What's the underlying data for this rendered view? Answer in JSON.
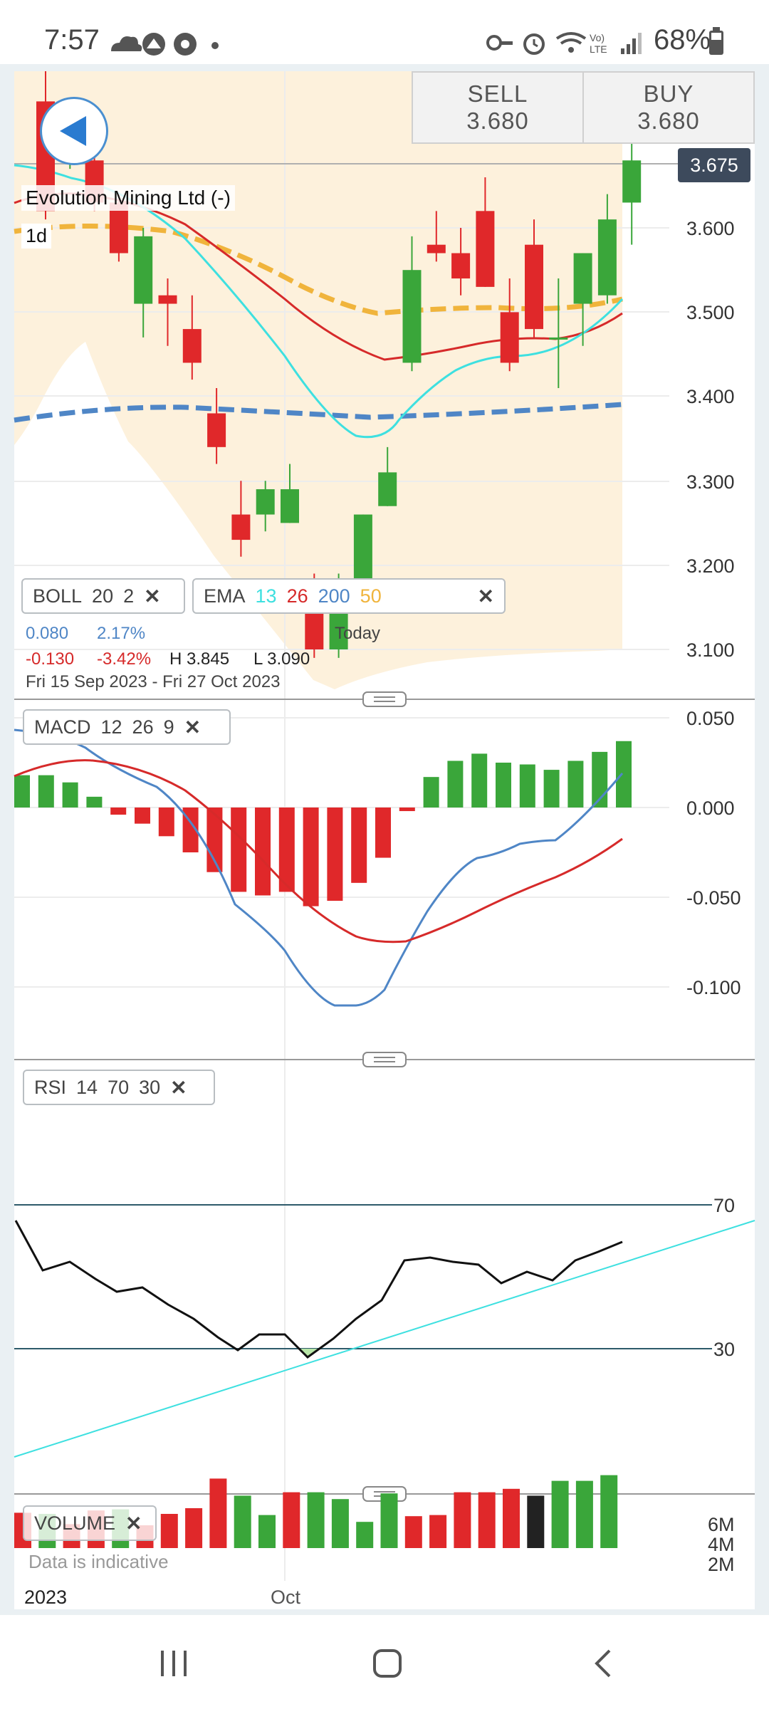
{
  "status_bar": {
    "time": "7:57",
    "battery": "68%",
    "icons": [
      "cloud-icon",
      "app-icon",
      "soccer-icon",
      "dot-icon",
      "key-icon",
      "alarm-icon",
      "wifi-icon",
      "volte-icon",
      "signal-icon",
      "battery-icon"
    ],
    "volte_label": "Vo) LTE"
  },
  "instrument": {
    "name": "Evolution Mining Ltd (-)",
    "timeframe": "1d",
    "current_price": "3.675"
  },
  "trade": {
    "sell_label": "SELL",
    "sell_price": "3.680",
    "buy_label": "BUY",
    "buy_price": "3.680"
  },
  "price_axis": [
    "3.600",
    "3.500",
    "3.400",
    "3.300",
    "3.200",
    "3.100"
  ],
  "boll": {
    "label": "BOLL",
    "period": "20",
    "dev": "2"
  },
  "ema": {
    "label": "EMA",
    "p1": "13",
    "p2": "26",
    "p3": "200",
    "p4": "50"
  },
  "colors": {
    "up": "#3aa63a",
    "down": "#e0282a",
    "ema13": "#3ee0e0",
    "ema26": "#d62a2a",
    "ema200": "#4f86c6",
    "ema50": "#f0b43c",
    "boll_band": "#fdf1dc"
  },
  "info": {
    "change_abs_up": "0.080",
    "change_pct_up": "2.17%",
    "change_abs_down": "-0.130",
    "change_pct_down": "-3.42%",
    "high": "H 3.845",
    "low": "L 3.090",
    "range": "Fri 15 Sep 2023 - Fri 27 Oct 2023",
    "today": "Today"
  },
  "macd": {
    "label": "MACD",
    "p1": "12",
    "p2": "26",
    "p3": "9",
    "axis": [
      "0.050",
      "0.000",
      "-0.050",
      "-0.100"
    ]
  },
  "rsi": {
    "label": "RSI",
    "p1": "14",
    "p2": "70",
    "p3": "30",
    "level_high": "70",
    "level_low": "30"
  },
  "volume": {
    "label": "VOLUME",
    "axis": [
      "6M",
      "4M",
      "2M"
    ],
    "note": "Data is indicative"
  },
  "time_axis": {
    "year": "2023",
    "month": "Oct"
  },
  "nav": {
    "icons": [
      "recents-icon",
      "home-icon",
      "back-icon"
    ]
  },
  "chart_data": {
    "type": "candlestick",
    "candles": [
      {
        "o": 3.75,
        "c": 3.62,
        "h": 3.79,
        "l": 3.61
      },
      {
        "o": 3.68,
        "c": 3.72,
        "h": 3.73,
        "l": 3.67
      },
      {
        "o": 3.68,
        "c": 3.63,
        "h": 3.7,
        "l": 3.62
      },
      {
        "o": 3.63,
        "c": 3.57,
        "h": 3.64,
        "l": 3.56
      },
      {
        "o": 3.51,
        "c": 3.59,
        "h": 3.6,
        "l": 3.47
      },
      {
        "o": 3.52,
        "c": 3.51,
        "h": 3.54,
        "l": 3.46
      },
      {
        "o": 3.48,
        "c": 3.44,
        "h": 3.52,
        "l": 3.42
      },
      {
        "o": 3.38,
        "c": 3.34,
        "h": 3.41,
        "l": 3.32
      },
      {
        "o": 3.26,
        "c": 3.23,
        "h": 3.3,
        "l": 3.21
      },
      {
        "o": 3.26,
        "c": 3.29,
        "h": 3.3,
        "l": 3.24
      },
      {
        "o": 3.25,
        "c": 3.29,
        "h": 3.32,
        "l": 3.25
      },
      {
        "o": 3.18,
        "c": 3.1,
        "h": 3.19,
        "l": 3.09
      },
      {
        "o": 3.1,
        "c": 3.18,
        "h": 3.19,
        "l": 3.09
      },
      {
        "o": 3.18,
        "c": 3.26,
        "h": 3.26,
        "l": 3.17
      },
      {
        "o": 3.27,
        "c": 3.31,
        "h": 3.34,
        "l": 3.27
      },
      {
        "o": 3.44,
        "c": 3.55,
        "h": 3.59,
        "l": 3.43
      },
      {
        "o": 3.58,
        "c": 3.57,
        "h": 3.62,
        "l": 3.56
      },
      {
        "o": 3.57,
        "c": 3.54,
        "h": 3.6,
        "l": 3.52
      },
      {
        "o": 3.62,
        "c": 3.53,
        "h": 3.66,
        "l": 3.53
      },
      {
        "o": 3.5,
        "c": 3.44,
        "h": 3.54,
        "l": 3.43
      },
      {
        "o": 3.58,
        "c": 3.48,
        "h": 3.61,
        "l": 3.47
      },
      {
        "o": 3.47,
        "c": 3.47,
        "h": 3.54,
        "l": 3.41
      },
      {
        "o": 3.51,
        "c": 3.57,
        "h": 3.57,
        "l": 3.46
      },
      {
        "o": 3.52,
        "c": 3.61,
        "h": 3.64,
        "l": 3.51
      },
      {
        "o": 3.63,
        "c": 3.68,
        "h": 3.72,
        "l": 3.58
      }
    ],
    "macd_histogram": [
      0.018,
      0.018,
      0.014,
      0.006,
      -0.004,
      -0.009,
      -0.016,
      -0.025,
      -0.036,
      -0.047,
      -0.049,
      -0.047,
      -0.055,
      -0.052,
      -0.042,
      -0.028,
      -0.002,
      0.017,
      0.026,
      0.03,
      0.025,
      0.024,
      0.021,
      0.026,
      0.031,
      0.037
    ],
    "volume": [
      3.1,
      3.0,
      2.1,
      3.3,
      3.4,
      2.0,
      3.0,
      3.5,
      6.1,
      4.6,
      2.9,
      4.9,
      4.9,
      4.3,
      2.3,
      4.8,
      2.8,
      2.9,
      4.9,
      4.9,
      5.2,
      4.6,
      5.9,
      5.9,
      6.4
    ]
  }
}
